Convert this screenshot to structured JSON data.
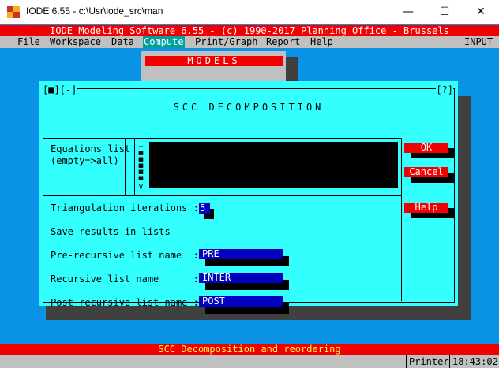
{
  "window": {
    "title": "IODE 6.55 - c:\\Usr\\iode_src\\man",
    "minimize_glyph": "—",
    "maximize_glyph": "☐",
    "close_glyph": "✕"
  },
  "banner": "IODE Modeling Software 6.55 - (c) 1990-2017 Planning Office - Brussels",
  "menu": {
    "items": [
      "File",
      "Workspace",
      "Data",
      "Compute",
      "Print/Graph",
      "Report",
      "Help"
    ],
    "active": "Compute",
    "mode": "INPUT"
  },
  "models_menu": {
    "title": "MODELS"
  },
  "dialog": {
    "title": "SCC DECOMPOSITION",
    "corner_left": "[■][-]",
    "corner_right": "[?]",
    "equations_label_line1": "Equations list",
    "equations_label_line2": "(empty=>all)",
    "scroll_top": "T",
    "scroll_bottom": "V",
    "triangulation_label": "Triangulation iterations :",
    "triangulation_value": "5",
    "save_results_label": "Save results in lists",
    "pre_label": "Pre-recursive list name  :",
    "pre_value": "PRE",
    "rec_label": "Recursive list name      :",
    "rec_value": "INTER",
    "post_label": "Post-recursive list name :",
    "post_value": "POST",
    "ok_label": "OK",
    "cancel_label": "Cancel",
    "help_label": "Help"
  },
  "status": {
    "message": "SCC Decomposition and reordering",
    "printer": "Printer",
    "time": "18:43:02"
  },
  "colors": {
    "desktop": "#0a93e4",
    "dialog_bg": "#33ffff",
    "accent_red": "#f00000",
    "field_blue": "#0000c0",
    "menu_gray": "#c0c0c0"
  }
}
